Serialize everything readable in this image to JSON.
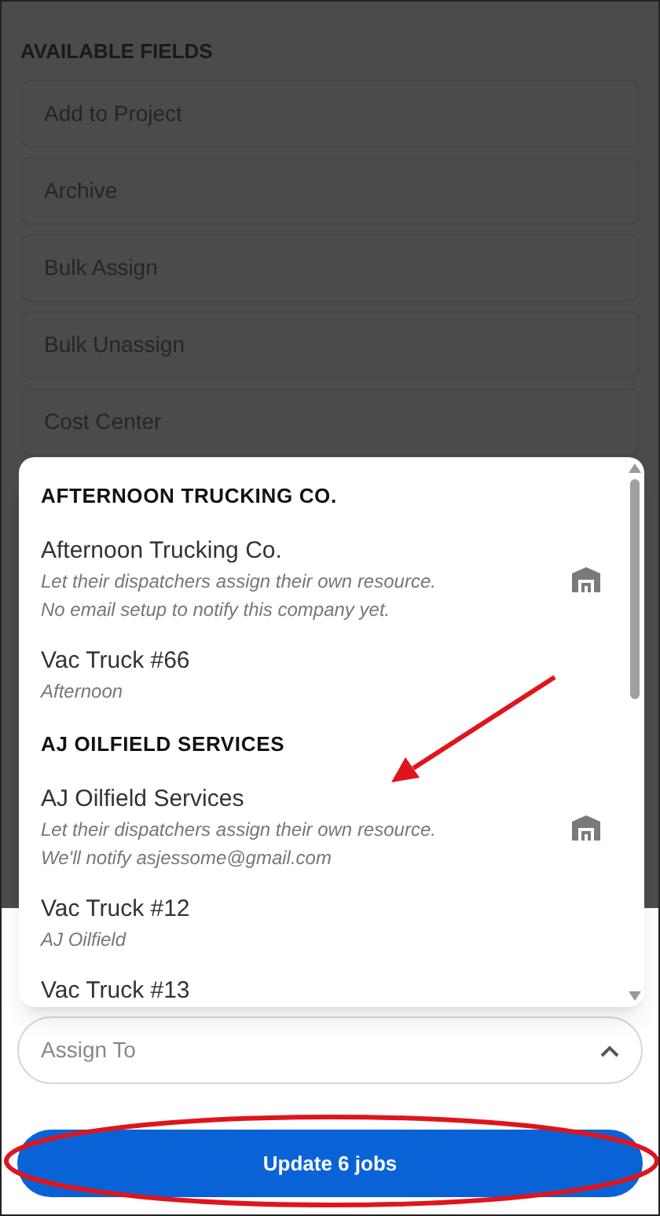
{
  "section_title": "AVAILABLE FIELDS",
  "fields": [
    "Add to Project",
    "Archive",
    "Bulk Assign",
    "Bulk Unassign",
    "Cost Center"
  ],
  "dropdown": {
    "items": [
      {
        "kind": "group",
        "title": "AFTERNOON TRUCKING CO."
      },
      {
        "kind": "company",
        "name": "Afternoon Trucking Co.",
        "lines": [
          "Let their dispatchers assign their own resource.",
          "No email setup to notify this company yet."
        ]
      },
      {
        "kind": "resource",
        "name": "Vac Truck #66",
        "sub": "Afternoon"
      },
      {
        "kind": "group",
        "title": "AJ OILFIELD SERVICES"
      },
      {
        "kind": "company",
        "name": "AJ Oilfield Services",
        "lines": [
          "Let their dispatchers assign their own resource.",
          "We'll notify asjessome@gmail.com"
        ]
      },
      {
        "kind": "resource",
        "name": "Vac Truck #12",
        "sub": "AJ Oilfield"
      },
      {
        "kind": "resource",
        "name": "Vac Truck #13"
      }
    ]
  },
  "assign_field": {
    "placeholder": "Assign To",
    "expanded": true
  },
  "submit_button": "Update 6 jobs"
}
